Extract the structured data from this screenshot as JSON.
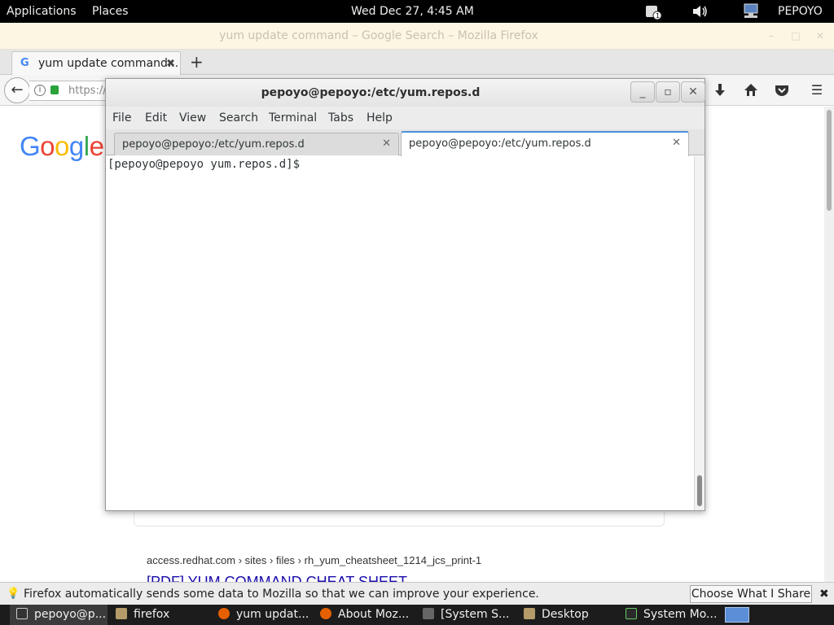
{
  "topbar": {
    "applications": "Applications",
    "places": "Places",
    "clock": "Wed Dec 27,  4:45 AM",
    "user": "PEPOYO"
  },
  "firefox": {
    "window_title": "yum update command – Google Search – Mozilla Firefox",
    "tab_label": "yum update command...",
    "url_text": "https://",
    "notification": "Firefox automatically sends some data to Mozilla so that we can improve your experience.",
    "notification_button": "Choose What I Share",
    "page": {
      "result_cite": "access.redhat.com › sites › files › rh_yum_cheatsheet_1214_jcs_print-1",
      "result_title": "[PDF] YUM COMMAND CHEAT SHEET"
    }
  },
  "terminal": {
    "title": "pepoyo@pepoyo:/etc/yum.repos.d",
    "menu": [
      "File",
      "Edit",
      "View",
      "Search",
      "Terminal",
      "Tabs",
      "Help"
    ],
    "tabs": [
      {
        "label": "pepoyo@pepoyo:/etc/yum.repos.d"
      },
      {
        "label": "pepoyo@pepoyo:/etc/yum.repos.d"
      }
    ],
    "prompt": "[pepoyo@pepoyo yum.repos.d]$"
  },
  "taskbar": {
    "items": [
      {
        "label": "pepoyo@p...",
        "icon": "terminal-icon",
        "active": true
      },
      {
        "label": "firefox",
        "icon": "folder-icon"
      },
      {
        "label": "yum updat...",
        "icon": "firefox-icon"
      },
      {
        "label": "About Moz...",
        "icon": "firefox-icon"
      },
      {
        "label": "[System S...",
        "icon": "system-settings-icon"
      },
      {
        "label": "Desktop",
        "icon": "folder-icon"
      },
      {
        "label": "System Mo...",
        "icon": "system-monitor-icon"
      }
    ]
  },
  "colors": {
    "accent": "#4a90d9",
    "link": "#1a0dab",
    "topbar_bg": "#000000",
    "taskbar_bg": "#1c1c1c"
  }
}
